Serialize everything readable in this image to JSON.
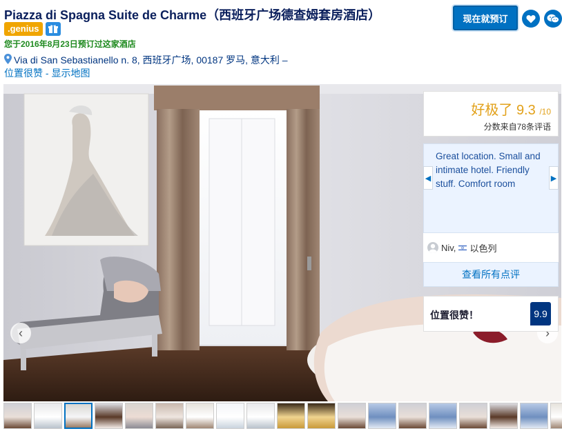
{
  "header": {
    "hotel_name": "Piazza di Spagna Suite de Charme（西班牙广场德查姆套房酒店）",
    "genius_label": ".genius",
    "booked_note": "您于2016年8月23日预订过这家酒店",
    "address": "Via di San Sebastianello n. 8, 西班牙广场, 00187 罗马, 意大利 –",
    "location_good": "位置很赞",
    "separator": " - ",
    "show_map": "显示地图",
    "book_now": "现在就预订"
  },
  "score": {
    "label": "好极了",
    "value": "9.3",
    "out_of": "/10",
    "based_on": "分数来自78条评语"
  },
  "review": {
    "text": "Great location. Small and intimate hotel. Friendly stuff. Comfort room",
    "reviewer_name": "Niv,",
    "reviewer_country": "以色列",
    "see_all": "查看所有点评"
  },
  "location_score": {
    "label": "位置很赞！",
    "value": "9.9"
  },
  "colors": {
    "brand_blue": "#003580",
    "link_blue": "#0071c2",
    "genius_orange": "#f0a500",
    "score_gold": "#e2a11a",
    "booked_green": "#1f8a1f"
  },
  "thumbnails": [
    {
      "theme": "room"
    },
    {
      "theme": "bath"
    },
    {
      "theme": "window"
    },
    {
      "theme": "bed"
    },
    {
      "theme": "sofa"
    },
    {
      "theme": "detail"
    },
    {
      "theme": "table"
    },
    {
      "theme": "bright"
    },
    {
      "theme": "bath"
    },
    {
      "theme": "gold"
    },
    {
      "theme": "gold"
    },
    {
      "theme": "room"
    },
    {
      "theme": "blue"
    },
    {
      "theme": "room"
    },
    {
      "theme": "blue"
    },
    {
      "theme": "room"
    },
    {
      "theme": "bed"
    },
    {
      "theme": "blue"
    },
    {
      "theme": "table"
    }
  ]
}
